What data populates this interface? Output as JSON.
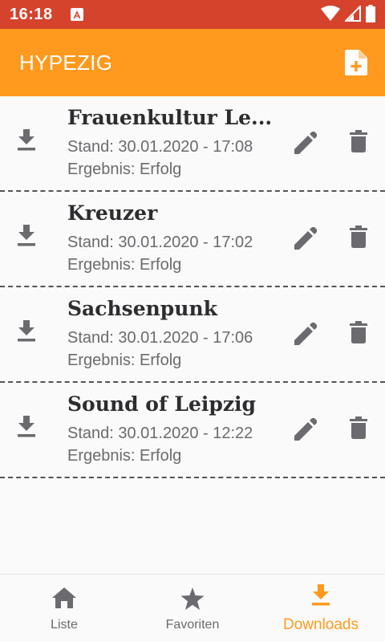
{
  "status_bar": {
    "time": "16:18",
    "icons": [
      "app-notification-icon",
      "wifi-icon",
      "signal-icon",
      "battery-icon"
    ]
  },
  "app_bar": {
    "title": "HYPEZIG",
    "action_icon": "add-file-icon"
  },
  "colors": {
    "status_bar": "#d5432d",
    "app_bar": "#ff9a1f",
    "accent": "#ff9a1f",
    "icon": "#6b6b6f",
    "title_text": "#2d2d30"
  },
  "downloads": [
    {
      "title": "Frauenkultur Le...",
      "stand": "Stand: 30.01.2020 - 17:08",
      "result": "Ergebnis: Erfolg"
    },
    {
      "title": "Kreuzer",
      "stand": "Stand: 30.01.2020 - 17:02",
      "result": "Ergebnis: Erfolg"
    },
    {
      "title": "Sachsenpunk",
      "stand": "Stand: 30.01.2020 - 17:06",
      "result": "Ergebnis: Erfolg"
    },
    {
      "title": "Sound of Leipzig",
      "stand": "Stand: 30.01.2020 - 12:22",
      "result": "Ergebnis: Erfolg"
    }
  ],
  "bottom_nav": {
    "items": [
      {
        "label": "Liste",
        "icon": "home-icon",
        "active": false
      },
      {
        "label": "Favoriten",
        "icon": "star-icon",
        "active": false
      },
      {
        "label": "Downloads",
        "icon": "download-icon",
        "active": true
      }
    ]
  }
}
